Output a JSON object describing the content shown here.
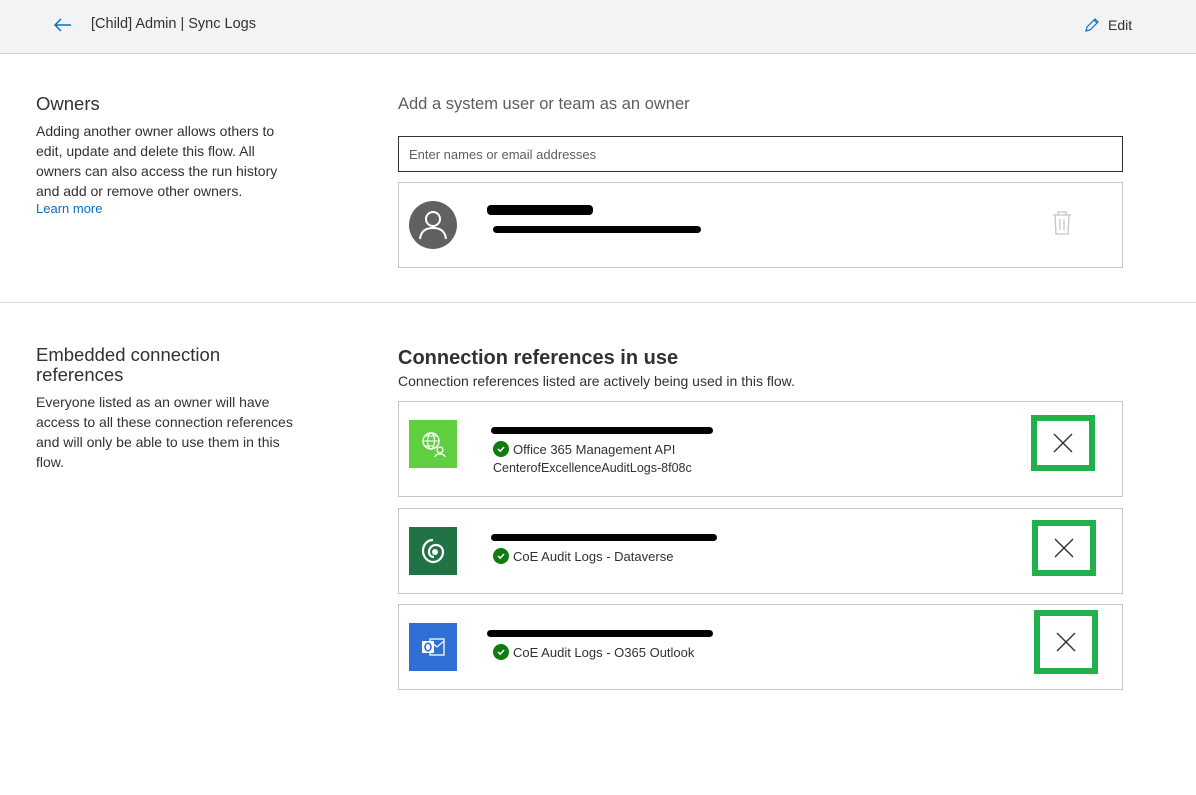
{
  "header": {
    "title": "[Child] Admin | Sync Logs",
    "edit_label": "Edit"
  },
  "owners": {
    "heading": "Owners",
    "description": "Adding another owner allows others to edit, update and delete this flow. All owners can also access the run history and add or remove other owners.",
    "learn_more": "Learn more",
    "prompt": "Add a system user or team as an owner",
    "input_placeholder": "Enter names or email addresses"
  },
  "embedded": {
    "heading": "Embedded connection references",
    "description": "Everyone listed as an owner will have access to all these connection references and will only be able to use them in this flow."
  },
  "connections": {
    "heading": "Connection references in use",
    "subheading": "Connection references listed are actively being used in this flow.",
    "items": [
      {
        "status_label": "Office 365 Management API",
        "detail": "CenterofExcellenceAuditLogs-8f08c",
        "icon": "office365-management-icon",
        "color": "#5fcf3f"
      },
      {
        "status_label": "CoE Audit Logs - Dataverse",
        "icon": "dataverse-icon",
        "color": "#217346"
      },
      {
        "status_label": "CoE Audit Logs - O365 Outlook",
        "icon": "outlook-icon",
        "color": "#2f6fd6"
      }
    ]
  },
  "colors": {
    "accent": "#0f6cbd",
    "highlight": "#21b04b",
    "success": "#107c10"
  }
}
